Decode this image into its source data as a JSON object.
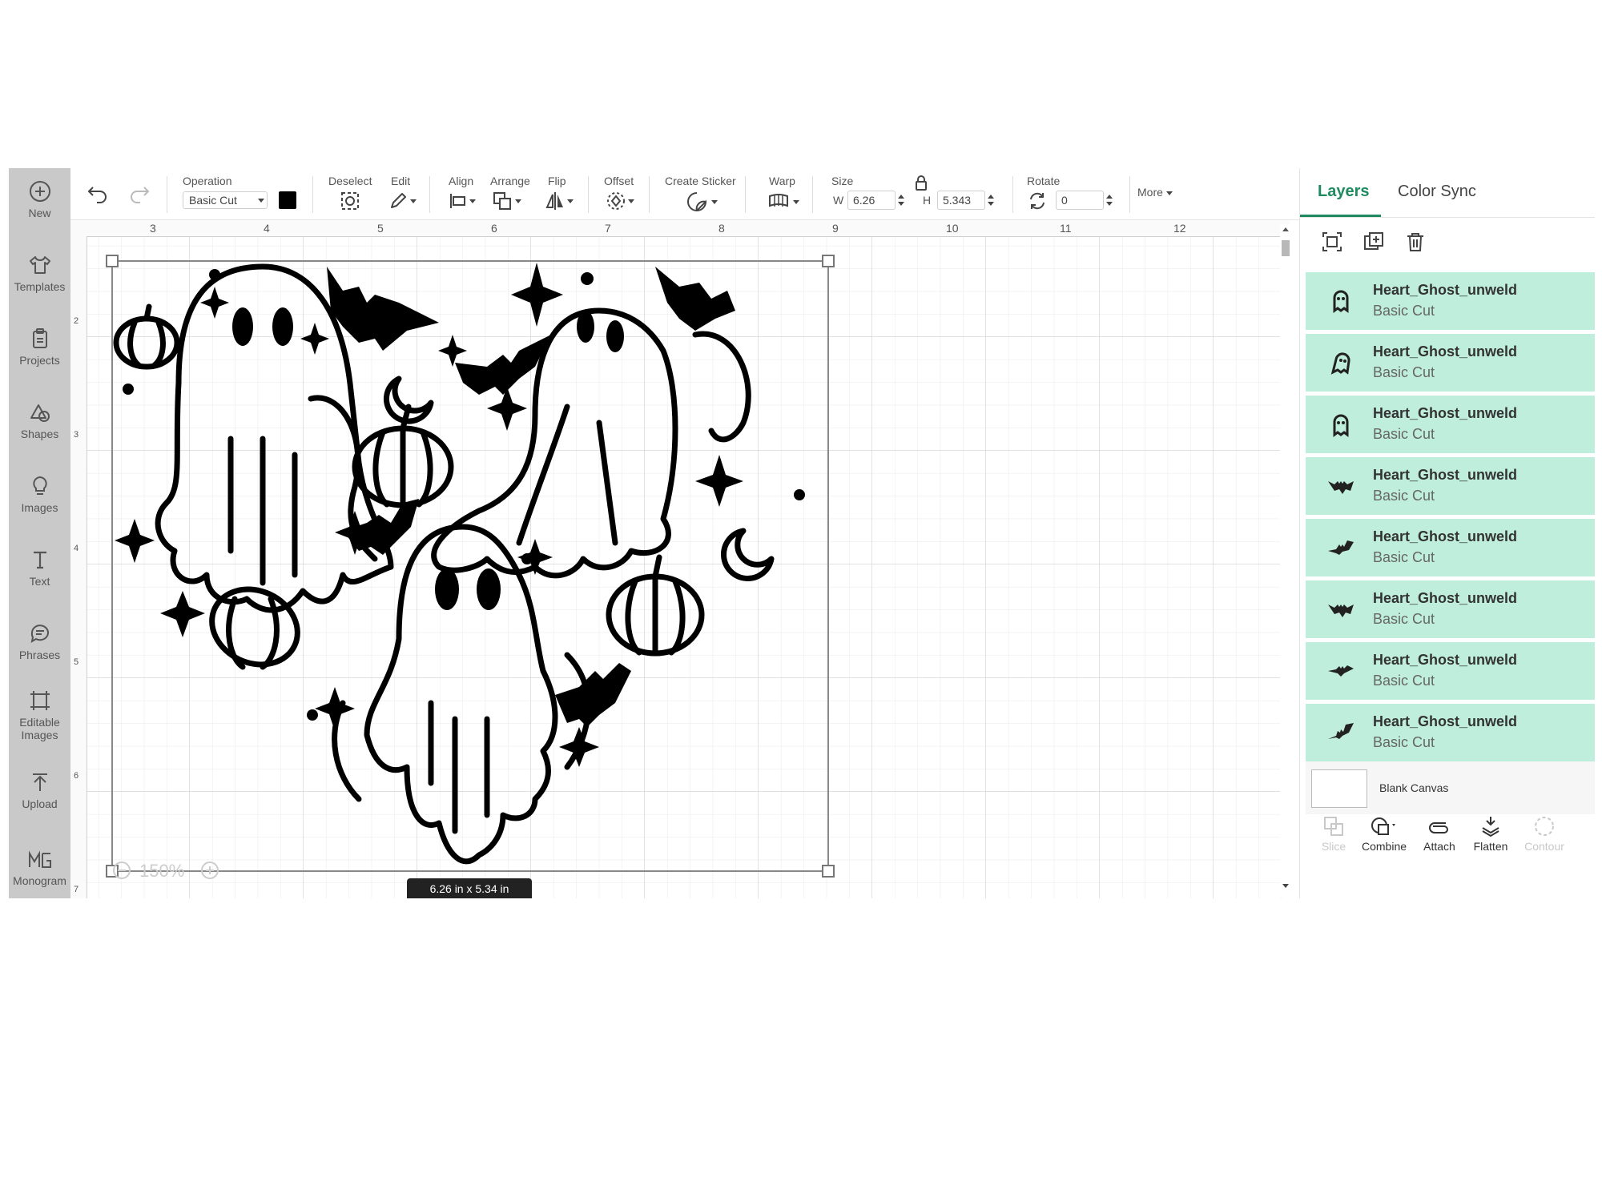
{
  "left_toolbar": {
    "items": [
      {
        "label": "New",
        "icon": "plus-circle-icon"
      },
      {
        "label": "Templates",
        "icon": "tshirt-icon"
      },
      {
        "label": "Projects",
        "icon": "clipboard-icon"
      },
      {
        "label": "Shapes",
        "icon": "shapes-icon"
      },
      {
        "label": "Images",
        "icon": "lightbulb-icon"
      },
      {
        "label": "Text",
        "icon": "text-icon"
      },
      {
        "label": "Phrases",
        "icon": "speech-bubble-icon"
      },
      {
        "label": "Editable",
        "label2": "Images",
        "icon": "editable-images-icon"
      },
      {
        "label": "Upload",
        "icon": "upload-icon"
      },
      {
        "label": "Monogram",
        "icon": "monogram-icon"
      }
    ]
  },
  "toolbar": {
    "operation_label": "Operation",
    "operation_value": "Basic Cut",
    "operation_color": "#000000",
    "deselect_label": "Deselect",
    "edit_label": "Edit",
    "align_label": "Align",
    "arrange_label": "Arrange",
    "flip_label": "Flip",
    "offset_label": "Offset",
    "create_sticker_label": "Create Sticker",
    "warp_label": "Warp",
    "size_label": "Size",
    "width_prefix": "W",
    "width_value": "6.26",
    "height_prefix": "H",
    "height_value": "5.343",
    "rotate_label": "Rotate",
    "rotate_value": "0",
    "more_label": "More"
  },
  "canvas": {
    "ruler_top": [
      "3",
      "4",
      "5",
      "6",
      "7",
      "8",
      "9",
      "10",
      "11",
      "12"
    ],
    "ruler_left": [
      "2",
      "3",
      "4",
      "5",
      "6",
      "7"
    ],
    "zoom": "150%",
    "size_readout": "6.26  in x 5.34  in"
  },
  "right_panel": {
    "tabs": [
      "Layers",
      "Color Sync"
    ],
    "active_tab": "Layers",
    "accent": "#1f8a5f",
    "layer_bg": "#bfeedd",
    "layers": [
      {
        "name": "Heart_Ghost_unweld",
        "operation": "Basic Cut",
        "thumb": "ghost-icon"
      },
      {
        "name": "Heart_Ghost_unweld",
        "operation": "Basic Cut",
        "thumb": "ghost-icon"
      },
      {
        "name": "Heart_Ghost_unweld",
        "operation": "Basic Cut",
        "thumb": "ghost-icon"
      },
      {
        "name": "Heart_Ghost_unweld",
        "operation": "Basic Cut",
        "thumb": "bat-icon"
      },
      {
        "name": "Heart_Ghost_unweld",
        "operation": "Basic Cut",
        "thumb": "bat-icon"
      },
      {
        "name": "Heart_Ghost_unweld",
        "operation": "Basic Cut",
        "thumb": "bat-icon"
      },
      {
        "name": "Heart_Ghost_unweld",
        "operation": "Basic Cut",
        "thumb": "bat-icon"
      },
      {
        "name": "Heart_Ghost_unweld",
        "operation": "Basic Cut",
        "thumb": "bat-icon"
      }
    ],
    "blank_canvas_label": "Blank Canvas",
    "bottom_tools": [
      {
        "label": "Slice",
        "enabled": false
      },
      {
        "label": "Combine",
        "enabled": true
      },
      {
        "label": "Attach",
        "enabled": true
      },
      {
        "label": "Flatten",
        "enabled": true
      },
      {
        "label": "Contour",
        "enabled": false
      }
    ]
  }
}
